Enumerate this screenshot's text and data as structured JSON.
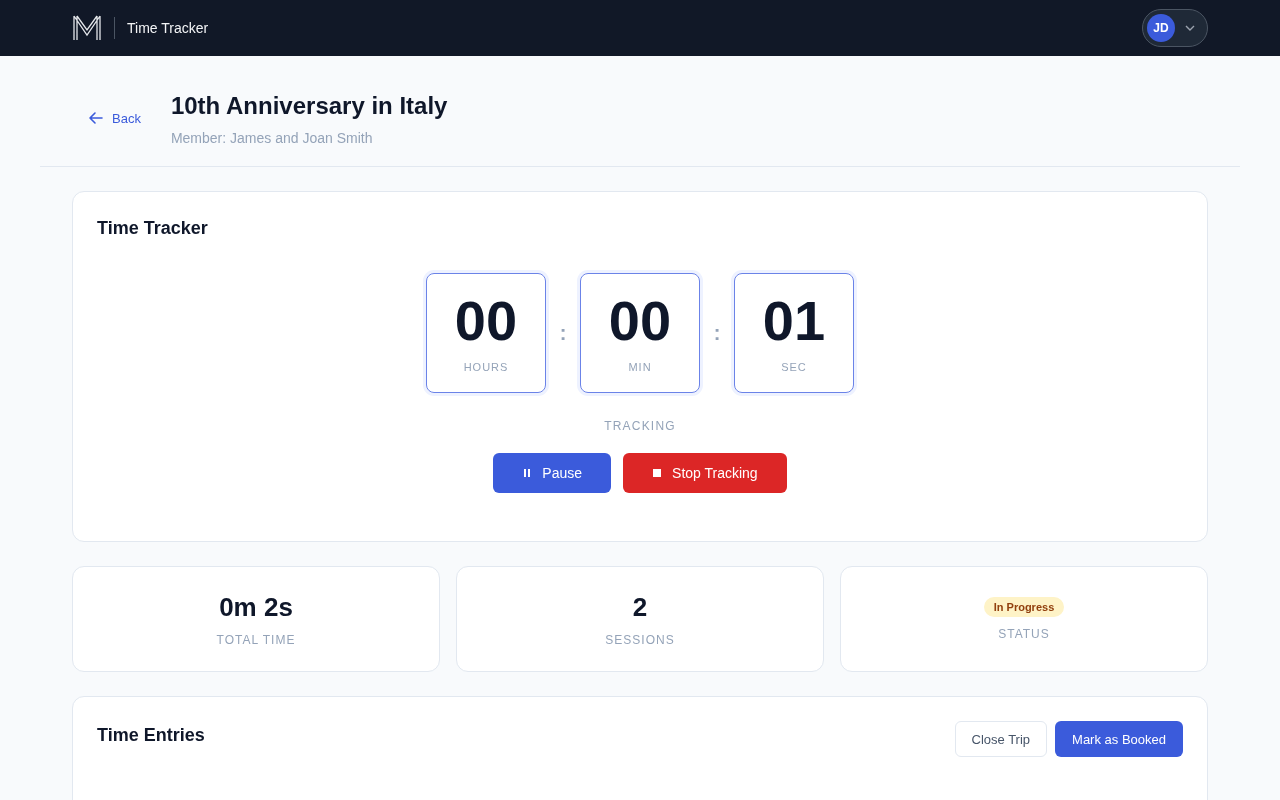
{
  "navbar": {
    "app_name": "Time Tracker",
    "user_initials": "JD"
  },
  "header": {
    "back_label": "Back",
    "title": "10th Anniversary in Italy",
    "subtitle": "Member: James and Joan Smith"
  },
  "tracker": {
    "title": "Time Tracker",
    "units": [
      {
        "value": "00",
        "label": "HOURS"
      },
      {
        "value": "00",
        "label": "MIN"
      },
      {
        "value": "01",
        "label": "SEC"
      }
    ],
    "separator": ":",
    "state_label": "TRACKING",
    "buttons": [
      {
        "label": "Pause",
        "kind": "primary"
      },
      {
        "label": "Stop Tracking",
        "kind": "danger"
      }
    ]
  },
  "stats": [
    {
      "kind": "value",
      "value": "0m 2s",
      "label": "TOTAL TIME"
    },
    {
      "kind": "value",
      "value": "2",
      "label": "SESSIONS"
    },
    {
      "kind": "badge",
      "value": "In Progress",
      "label": "STATUS",
      "color": "#fef3c7"
    }
  ],
  "entries": {
    "title": "Time Entries",
    "buttons": [
      {
        "label": "Close Trip",
        "kind": "secondary"
      },
      {
        "label": "Mark as Booked",
        "kind": "primary"
      }
    ]
  }
}
